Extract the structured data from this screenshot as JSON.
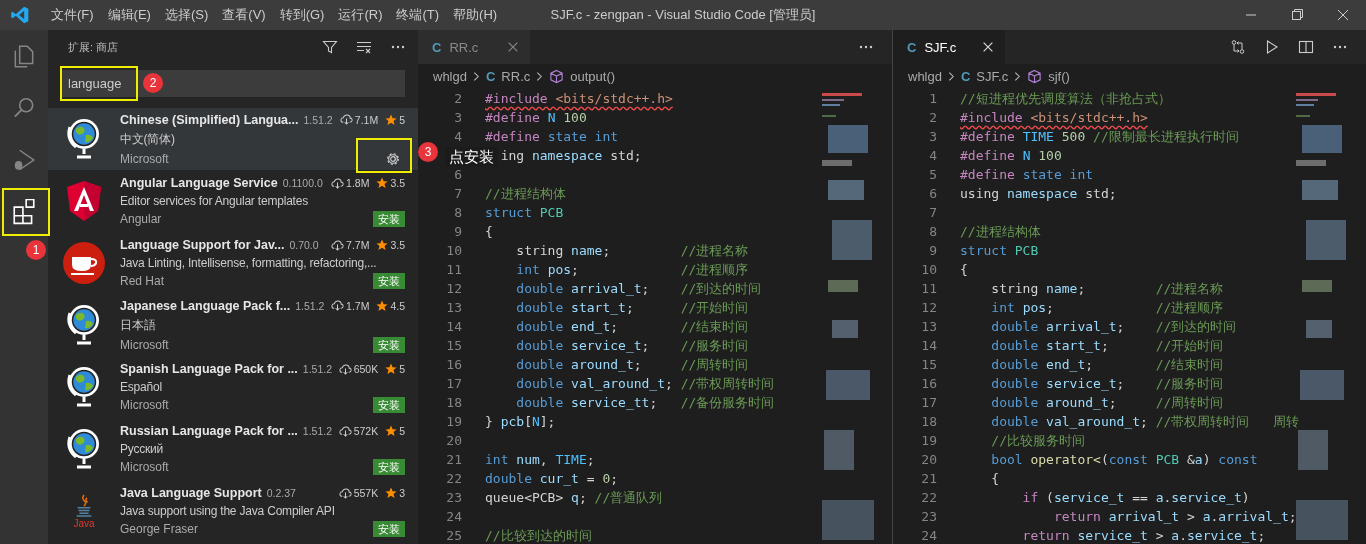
{
  "window": {
    "title": "SJF.c - zengpan - Visual Studio Code [管理员]"
  },
  "menu": [
    "文件(F)",
    "编辑(E)",
    "选择(S)",
    "查看(V)",
    "转到(G)",
    "运行(R)",
    "终端(T)",
    "帮助(H)"
  ],
  "activity_bar": [
    {
      "kind": "files",
      "selected": false,
      "highlighted": false
    },
    {
      "kind": "search",
      "selected": false,
      "highlighted": false
    },
    {
      "kind": "debug",
      "selected": false,
      "highlighted": false
    },
    {
      "kind": "extensions",
      "selected": true,
      "highlighted": true,
      "step": "1"
    }
  ],
  "sidebar": {
    "title": "扩展: 商店",
    "search": {
      "value": "language",
      "highlighted": true,
      "step": "2"
    },
    "extensions": [
      {
        "kind": "globe",
        "name": "Chinese (Simplified) Langua...",
        "version": "1.51.2",
        "downloads": "7.1M",
        "rating": "5",
        "description": "中文(简体)",
        "publisher": "Microsoft",
        "installed": true,
        "selected": true,
        "highlighted": true,
        "step": "3",
        "tooltip": "点安装"
      },
      {
        "kind": "shield",
        "name": "Angular Language Service",
        "version": "0.1100.0",
        "downloads": "1.8M",
        "rating": "3.5",
        "description": "Editor services for Angular templates",
        "publisher": "Angular",
        "installed": false,
        "selected": false,
        "highlighted": false,
        "action": "安装"
      },
      {
        "kind": "cup",
        "name": "Language Support for Jav...",
        "version": "0.70.0",
        "downloads": "7.7M",
        "rating": "3.5",
        "description": "Java Linting, Intellisense, formatting, refactoring,...",
        "publisher": "Red Hat",
        "installed": false,
        "selected": false,
        "highlighted": false,
        "action": "安装"
      },
      {
        "kind": "globe",
        "name": "Japanese Language Pack f...",
        "version": "1.51.2",
        "downloads": "1.7M",
        "rating": "4.5",
        "description": "日本語",
        "publisher": "Microsoft",
        "installed": false,
        "selected": false,
        "highlighted": false,
        "action": "安装"
      },
      {
        "kind": "globe",
        "name": "Spanish Language Pack for ...",
        "version": "1.51.2",
        "downloads": "650K",
        "rating": "5",
        "description": "Español",
        "publisher": "Microsoft",
        "installed": false,
        "selected": false,
        "highlighted": false,
        "action": "安装"
      },
      {
        "kind": "globe",
        "name": "Russian Language Pack for ...",
        "version": "1.51.2",
        "downloads": "572K",
        "rating": "5",
        "description": "Русский",
        "publisher": "Microsoft",
        "installed": false,
        "selected": false,
        "highlighted": false,
        "action": "安装"
      },
      {
        "kind": "coffee",
        "logo_text": "Java",
        "name": "Java Language Support",
        "version": "0.2.37",
        "downloads": "557K",
        "rating": "3",
        "description": "Java support using the Java Compiler API",
        "publisher": "George Fraser",
        "installed": false,
        "selected": false,
        "highlighted": false,
        "action": "安装"
      }
    ]
  },
  "editors": [
    {
      "tab": {
        "icon_text": "C",
        "label": "RR.c",
        "focused": false
      },
      "actions": [
        {
          "kind": "more"
        }
      ],
      "breadcrumb": [
        {
          "kind": "folder",
          "label": "whlgd"
        },
        {
          "kind": "file",
          "icon_text": "C",
          "label": "RR.c"
        },
        {
          "kind": "symbol",
          "label": "output()"
        }
      ],
      "lines": [
        {
          "n": "2",
          "tokens": [
            {
              "kind": "dir_err",
              "text": "#include "
            },
            {
              "kind": "str_err",
              "text": "<bits/stdc++.h>"
            }
          ]
        },
        {
          "n": "3",
          "tokens": [
            {
              "kind": "dir",
              "text": "#define "
            },
            {
              "kind": "mac",
              "text": "N "
            },
            {
              "kind": "num",
              "text": "100"
            }
          ]
        },
        {
          "n": "4",
          "tokens": [
            {
              "kind": "dir",
              "text": "#define "
            },
            {
              "kind": "kw",
              "text": "state "
            },
            {
              "kind": "kw",
              "text": "int"
            }
          ]
        },
        {
          "tokens": [
            {
              "kind": "txt",
              "text": "ing "
            },
            {
              "kind": "var",
              "text": "namespace"
            },
            {
              "kind": "txt",
              "text": " std;"
            }
          ]
        },
        {
          "n": "6"
        },
        {
          "n": "7",
          "tokens": [
            {
              "kind": "cmt",
              "text": "//进程结构体"
            }
          ]
        },
        {
          "n": "8",
          "tokens": [
            {
              "kind": "kw",
              "text": "struct "
            },
            {
              "kind": "typ",
              "text": "PCB"
            }
          ]
        },
        {
          "n": "9",
          "tokens": [
            {
              "kind": "txt",
              "text": "{"
            }
          ]
        },
        {
          "n": "10",
          "tokens": [
            {
              "kind": "txt",
              "text": "    string "
            },
            {
              "kind": "var",
              "text": "name"
            },
            {
              "kind": "txt",
              "text": ";         "
            },
            {
              "kind": "cmt",
              "text": "//进程名称"
            }
          ]
        },
        {
          "n": "11",
          "tokens": [
            {
              "kind": "kw",
              "text": "    int "
            },
            {
              "kind": "var",
              "text": "pos"
            },
            {
              "kind": "txt",
              "text": ";             "
            },
            {
              "kind": "cmt",
              "text": "//进程顺序"
            }
          ]
        },
        {
          "n": "12",
          "tokens": [
            {
              "kind": "kw",
              "text": "    double "
            },
            {
              "kind": "var",
              "text": "arrival_t"
            },
            {
              "kind": "txt",
              "text": ";    "
            },
            {
              "kind": "cmt",
              "text": "//到达的时间"
            }
          ]
        },
        {
          "n": "13",
          "tokens": [
            {
              "kind": "kw",
              "text": "    double "
            },
            {
              "kind": "var",
              "text": "start_t"
            },
            {
              "kind": "txt",
              "text": ";      "
            },
            {
              "kind": "cmt",
              "text": "//开始时间"
            }
          ]
        },
        {
          "n": "14",
          "tokens": [
            {
              "kind": "kw",
              "text": "    double "
            },
            {
              "kind": "var",
              "text": "end_t"
            },
            {
              "kind": "txt",
              "text": ";        "
            },
            {
              "kind": "cmt",
              "text": "//结束时间"
            }
          ]
        },
        {
          "n": "15",
          "tokens": [
            {
              "kind": "kw",
              "text": "    double "
            },
            {
              "kind": "var",
              "text": "service_t"
            },
            {
              "kind": "txt",
              "text": ";    "
            },
            {
              "kind": "cmt",
              "text": "//服务时间"
            }
          ]
        },
        {
          "n": "16",
          "tokens": [
            {
              "kind": "kw",
              "text": "    double "
            },
            {
              "kind": "var",
              "text": "around_t"
            },
            {
              "kind": "txt",
              "text": ";     "
            },
            {
              "kind": "cmt",
              "text": "//周转时间"
            }
          ]
        },
        {
          "n": "17",
          "tokens": [
            {
              "kind": "kw",
              "text": "    double "
            },
            {
              "kind": "var",
              "text": "val_around_t"
            },
            {
              "kind": "txt",
              "text": "; "
            },
            {
              "kind": "cmt",
              "text": "//带权周转时间"
            }
          ]
        },
        {
          "n": "18",
          "tokens": [
            {
              "kind": "kw",
              "text": "    double "
            },
            {
              "kind": "var",
              "text": "service_tt"
            },
            {
              "kind": "txt",
              "text": ";   "
            },
            {
              "kind": "cmt",
              "text": "//备份服务时间"
            }
          ]
        },
        {
          "n": "19",
          "tokens": [
            {
              "kind": "txt",
              "text": "} "
            },
            {
              "kind": "var",
              "text": "pcb"
            },
            {
              "kind": "txt",
              "text": "["
            },
            {
              "kind": "mac",
              "text": "N"
            },
            {
              "kind": "txt",
              "text": "];"
            }
          ]
        },
        {
          "n": "20"
        },
        {
          "n": "21",
          "tokens": [
            {
              "kind": "kw",
              "text": "int "
            },
            {
              "kind": "var",
              "text": "num"
            },
            {
              "kind": "txt",
              "text": ", "
            },
            {
              "kind": "mac",
              "text": "TIME"
            },
            {
              "kind": "txt",
              "text": ";"
            }
          ]
        },
        {
          "n": "22",
          "tokens": [
            {
              "kind": "kw",
              "text": "double "
            },
            {
              "kind": "var",
              "text": "cur_t"
            },
            {
              "kind": "txt",
              "text": " = "
            },
            {
              "kind": "num",
              "text": "0"
            },
            {
              "kind": "txt",
              "text": ";"
            }
          ]
        },
        {
          "n": "23",
          "tokens": [
            {
              "kind": "txt",
              "text": "queue<PCB> "
            },
            {
              "kind": "var",
              "text": "q"
            },
            {
              "kind": "txt",
              "text": "; "
            },
            {
              "kind": "cmt",
              "text": "//普通队列"
            }
          ]
        },
        {
          "n": "24"
        },
        {
          "n": "25",
          "tokens": [
            {
              "kind": "cmt",
              "text": "//比较到达的时间"
            }
          ]
        }
      ]
    },
    {
      "tab": {
        "icon_text": "C",
        "label": "SJF.c",
        "focused": true
      },
      "actions": [
        {
          "kind": "compare"
        },
        {
          "kind": "run"
        },
        {
          "kind": "split"
        },
        {
          "kind": "more"
        }
      ],
      "breadcrumb": [
        {
          "kind": "folder",
          "label": "whlgd"
        },
        {
          "kind": "file",
          "icon_text": "C",
          "label": "SJF.c"
        },
        {
          "kind": "symbol",
          "label": "sjf()"
        }
      ],
      "lines": [
        {
          "n": "1",
          "tokens": [
            {
              "kind": "cmt",
              "text": "//短进程优先调度算法（非抢占式）"
            }
          ]
        },
        {
          "n": "2",
          "tokens": [
            {
              "kind": "dir_err",
              "text": "#include "
            },
            {
              "kind": "str_err",
              "text": "<bits/stdc++.h>"
            }
          ]
        },
        {
          "n": "3",
          "tokens": [
            {
              "kind": "dir",
              "text": "#define "
            },
            {
              "kind": "mac",
              "text": "TIME "
            },
            {
              "kind": "num",
              "text": "500 "
            },
            {
              "kind": "cmt",
              "text": "//限制最长进程执行时间"
            }
          ]
        },
        {
          "n": "4",
          "tokens": [
            {
              "kind": "dir",
              "text": "#define "
            },
            {
              "kind": "mac",
              "text": "N "
            },
            {
              "kind": "num",
              "text": "100"
            }
          ]
        },
        {
          "n": "5",
          "tokens": [
            {
              "kind": "dir",
              "text": "#define "
            },
            {
              "kind": "kw",
              "text": "state "
            },
            {
              "kind": "kw",
              "text": "int"
            }
          ]
        },
        {
          "n": "6",
          "tokens": [
            {
              "kind": "txt",
              "text": "using "
            },
            {
              "kind": "var",
              "text": "namespace"
            },
            {
              "kind": "txt",
              "text": " std;"
            }
          ]
        },
        {
          "n": "7"
        },
        {
          "n": "8",
          "tokens": [
            {
              "kind": "cmt",
              "text": "//进程结构体"
            }
          ]
        },
        {
          "n": "9",
          "tokens": [
            {
              "kind": "kw",
              "text": "struct "
            },
            {
              "kind": "typ",
              "text": "PCB"
            }
          ]
        },
        {
          "n": "10",
          "tokens": [
            {
              "kind": "txt",
              "text": "{"
            }
          ]
        },
        {
          "n": "11",
          "tokens": [
            {
              "kind": "txt",
              "text": "    string "
            },
            {
              "kind": "var",
              "text": "name"
            },
            {
              "kind": "txt",
              "text": ";         "
            },
            {
              "kind": "cmt",
              "text": "//进程名称"
            }
          ]
        },
        {
          "n": "12",
          "tokens": [
            {
              "kind": "kw",
              "text": "    int "
            },
            {
              "kind": "var",
              "text": "pos"
            },
            {
              "kind": "txt",
              "text": ";             "
            },
            {
              "kind": "cmt",
              "text": "//进程顺序"
            }
          ]
        },
        {
          "n": "13",
          "tokens": [
            {
              "kind": "kw",
              "text": "    double "
            },
            {
              "kind": "var",
              "text": "arrival_t"
            },
            {
              "kind": "txt",
              "text": ";    "
            },
            {
              "kind": "cmt",
              "text": "//到达的时间"
            }
          ]
        },
        {
          "n": "14",
          "tokens": [
            {
              "kind": "kw",
              "text": "    double "
            },
            {
              "kind": "var",
              "text": "start_t"
            },
            {
              "kind": "txt",
              "text": ";      "
            },
            {
              "kind": "cmt",
              "text": "//开始时间"
            }
          ]
        },
        {
          "n": "15",
          "tokens": [
            {
              "kind": "kw",
              "text": "    double "
            },
            {
              "kind": "var",
              "text": "end_t"
            },
            {
              "kind": "txt",
              "text": ";        "
            },
            {
              "kind": "cmt",
              "text": "//结束时间"
            }
          ]
        },
        {
          "n": "16",
          "tokens": [
            {
              "kind": "kw",
              "text": "    double "
            },
            {
              "kind": "var",
              "text": "service_t"
            },
            {
              "kind": "txt",
              "text": ";    "
            },
            {
              "kind": "cmt",
              "text": "//服务时间"
            }
          ]
        },
        {
          "n": "17",
          "tokens": [
            {
              "kind": "kw",
              "text": "    double "
            },
            {
              "kind": "var",
              "text": "around_t"
            },
            {
              "kind": "txt",
              "text": ";     "
            },
            {
              "kind": "cmt",
              "text": "//周转时间"
            }
          ]
        },
        {
          "n": "18",
          "tokens": [
            {
              "kind": "kw",
              "text": "    double "
            },
            {
              "kind": "var",
              "text": "val_around_t"
            },
            {
              "kind": "txt",
              "text": "; "
            },
            {
              "kind": "cmt",
              "text": "//带权周转时间   周转"
            }
          ]
        },
        {
          "n": "19",
          "tokens": [
            {
              "kind": "cmt",
              "text": "    //比较服务时间"
            }
          ]
        },
        {
          "n": "20",
          "tokens": [
            {
              "kind": "kw",
              "text": "    bool "
            },
            {
              "kind": "fn",
              "text": "operator<"
            },
            {
              "kind": "txt",
              "text": "("
            },
            {
              "kind": "kw",
              "text": "const "
            },
            {
              "kind": "typ",
              "text": "PCB "
            },
            {
              "kind": "txt",
              "text": "&"
            },
            {
              "kind": "var",
              "text": "a"
            },
            {
              "kind": "txt",
              "text": ") "
            },
            {
              "kind": "kw",
              "text": "const"
            }
          ]
        },
        {
          "n": "21",
          "tokens": [
            {
              "kind": "txt",
              "text": "    {"
            }
          ]
        },
        {
          "n": "22",
          "tokens": [
            {
              "kind": "ctl",
              "text": "        if "
            },
            {
              "kind": "txt",
              "text": "("
            },
            {
              "kind": "var",
              "text": "service_t"
            },
            {
              "kind": "txt",
              "text": " == "
            },
            {
              "kind": "var",
              "text": "a"
            },
            {
              "kind": "txt",
              "text": "."
            },
            {
              "kind": "var",
              "text": "service_t"
            },
            {
              "kind": "txt",
              "text": ")"
            }
          ]
        },
        {
          "n": "23",
          "tokens": [
            {
              "kind": "ctl",
              "text": "            return "
            },
            {
              "kind": "var",
              "text": "arrival_t"
            },
            {
              "kind": "txt",
              "text": " > "
            },
            {
              "kind": "var",
              "text": "a"
            },
            {
              "kind": "txt",
              "text": "."
            },
            {
              "kind": "var",
              "text": "arrival_t"
            },
            {
              "kind": "txt",
              "text": ";"
            }
          ]
        },
        {
          "n": "24",
          "tokens": [
            {
              "kind": "ctl",
              "text": "        return "
            },
            {
              "kind": "var",
              "text": "service_t"
            },
            {
              "kind": "txt",
              "text": " > "
            },
            {
              "kind": "var",
              "text": "a"
            },
            {
              "kind": "txt",
              "text": "."
            },
            {
              "kind": "var",
              "text": "service_t"
            },
            {
              "kind": "txt",
              "text": ";"
            }
          ]
        }
      ]
    }
  ]
}
